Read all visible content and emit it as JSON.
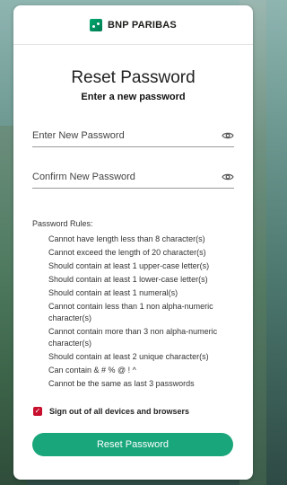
{
  "brand": {
    "name": "BNP PARIBAS",
    "color": "#00915a"
  },
  "page": {
    "title": "Reset Password",
    "subtitle": "Enter a new password"
  },
  "fields": {
    "new_password": {
      "placeholder": "Enter New Password",
      "icon": "eye-icon"
    },
    "confirm_password": {
      "placeholder": "Confirm New Password",
      "icon": "eye-icon"
    }
  },
  "rules": {
    "title": "Password Rules:",
    "items": [
      "Cannot have length less than 8 character(s)",
      "Cannot exceed the length of 20 character(s)",
      "Should contain at least 1 upper-case letter(s)",
      "Should contain at least 1 lower-case letter(s)",
      "Should contain at least 1 numeral(s)",
      "Cannot contain less than 1 non alpha-numeric character(s)",
      "Cannot contain more than 3 non alpha-numeric character(s)",
      "Should contain at least 2 unique character(s)",
      "Can contain & # % @ ! ^",
      "Cannot be the same as last 3 passwords"
    ]
  },
  "signout": {
    "label": "Sign out of all devices and browsers",
    "checked": true,
    "color": "#c8102e"
  },
  "submit": {
    "label": "Reset Password",
    "color": "#19a67a"
  }
}
